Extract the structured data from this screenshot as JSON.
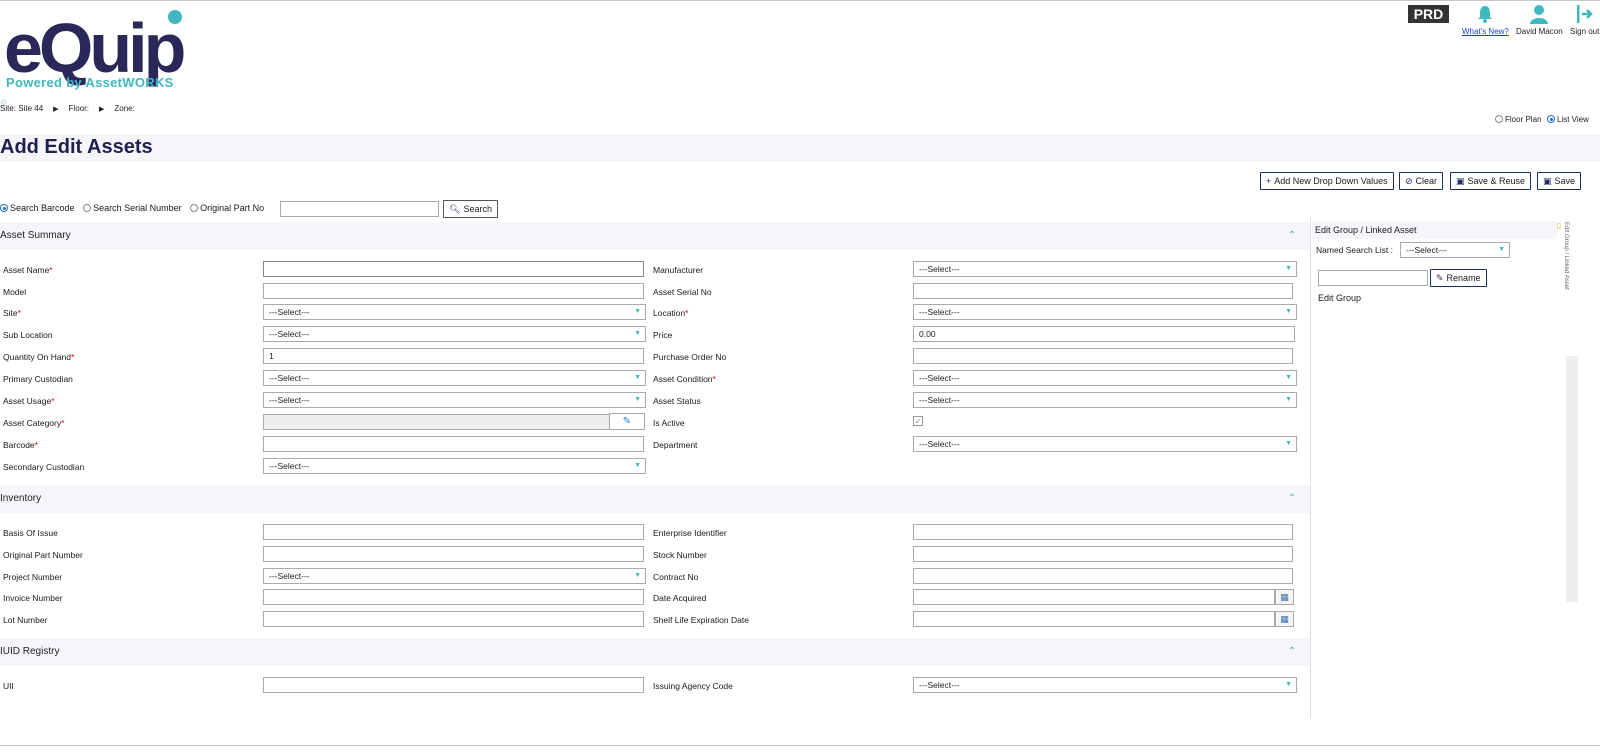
{
  "header": {
    "logo_text": "eQuip",
    "logo_powered": "Powered by AssetWORKS",
    "env_badge": "PRD",
    "whats_new": "What's New?",
    "user_name": "David Macon",
    "sign_out": "Sign out"
  },
  "breadcrumb": {
    "site": "Site: Site 44",
    "floor": "Floor:",
    "zone": "Zone:"
  },
  "view_toggle": {
    "floor_plan": "Floor Plan",
    "list_view": "List View",
    "selected": "List View"
  },
  "page": {
    "title": "Add Edit Assets"
  },
  "toolbar": {
    "add_dropdown": "Add New Drop Down Values",
    "clear": "Clear",
    "save_reuse": "Save & Reuse",
    "save": "Save"
  },
  "search": {
    "options": [
      "Search Barcode",
      "Search Serial Number",
      "Original Part No"
    ],
    "selected": "Search Barcode",
    "value": "",
    "button": "Search"
  },
  "asset_summary": {
    "title": "Asset Summary",
    "asset_name": "Asset Name",
    "manufacturer": "Manufacturer",
    "manufacturer_value": "---Select---",
    "model": "Model",
    "asset_serial_no": "Asset Serial No",
    "site": "Site",
    "site_value": "---Select---",
    "location": "Location",
    "location_value": "---Select---",
    "sub_location": "Sub Location",
    "sub_location_value": "---Select---",
    "price": "Price",
    "price_value": "0.00",
    "quantity_on_hand": "Quantity On Hand",
    "quantity_value": "1",
    "purchase_order_no": "Purchase Order No",
    "primary_custodian": "Primary Custodian",
    "primary_custodian_value": "---Select---",
    "asset_condition": "Asset Condition",
    "asset_condition_value": "---Select---",
    "asset_usage": "Asset Usage",
    "asset_usage_value": "---Select---",
    "asset_status": "Asset Status",
    "asset_status_value": "---Select---",
    "asset_category": "Asset Category",
    "is_active": "Is Active",
    "barcode": "Barcode",
    "department": "Department",
    "department_value": "---Select---",
    "secondary_custodian": "Secondary Custodian",
    "secondary_custodian_value": "---Select---"
  },
  "inventory": {
    "title": "Inventory",
    "basis_of_issue": "Basis Of Issue",
    "enterprise_identifier": "Enterprise Identifier",
    "original_part_number": "Original Part Number",
    "stock_number": "Stock Number",
    "project_number": "Project Number",
    "project_number_value": "---Select---",
    "contract_no": "Contract No",
    "invoice_number": "Invoice Number",
    "date_acquired": "Date Acquired",
    "lot_number": "Lot Number",
    "shelf_life": "Shelf Life Expiration Date"
  },
  "iuid": {
    "title": "IUID Registry",
    "uii": "UII",
    "issuing_agency_code": "Issuing Agency Code",
    "issuing_agency_value": "---Select---"
  },
  "right_panel": {
    "title": "Edit Group / Linked Asset",
    "named_search_label": "Named Search List :",
    "named_search_value": "---Select---",
    "rename": "Rename",
    "edit_group": "Edit Group",
    "tab_label": "Edit Group / Linked Asset"
  },
  "colors": {
    "brand_navy": "#2a2759",
    "brand_teal": "#3fb8c0",
    "required": "#dd0000"
  }
}
